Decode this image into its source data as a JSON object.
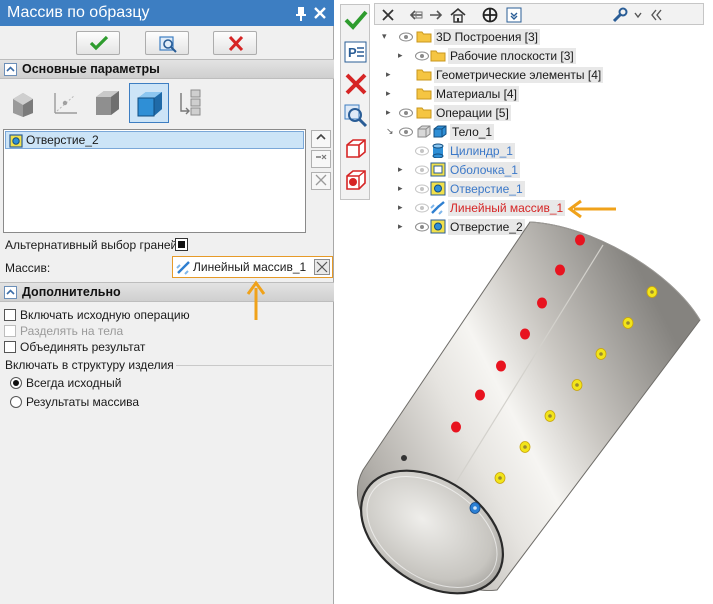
{
  "dialog": {
    "title": "Массив по образцу",
    "icons": {
      "pin": "pin-icon",
      "close": "close-icon"
    }
  },
  "commands": {
    "ok_icon": "checkmark-icon",
    "preview_icon": "preview-icon",
    "cancel_icon": "cancel-x-icon"
  },
  "main_section": {
    "title": "Основные параметры",
    "mode_icons": [
      "face-mode-icon",
      "edge-mode-icon",
      "body-mode-icon",
      "solid-mode-icon",
      "pattern-mode-icon"
    ],
    "selected_mode_index": 3,
    "list_items": [
      "Отверстие_2"
    ],
    "alt_face_selection_label": "Альтернативный выбор граней:",
    "pattern_label": "Массив:",
    "pattern_value": "Линейный массив_1"
  },
  "extra_section": {
    "title": "Дополнительно",
    "include_original_label": "Включать исходную операцию",
    "split_bodies_label": "Разделять на тела",
    "merge_result_label": "Объединять результат",
    "structure_group_label": "Включать в структуру изделия",
    "radio_always_original": "Всегда исходный",
    "radio_array_results": "Результаты массива"
  },
  "tree": {
    "nodes": [
      {
        "label": "3D Построения [3]",
        "style": "normal"
      },
      {
        "label": "Рабочие плоскости [3]",
        "style": "normal"
      },
      {
        "label": "Геометрические элементы [4]",
        "style": "normal"
      },
      {
        "label": "Материалы [4]",
        "style": "normal"
      },
      {
        "label": "Операции [5]",
        "style": "normal"
      },
      {
        "label": "Тело_1",
        "style": "normal"
      },
      {
        "label": "Цилиндр_1",
        "style": "blue"
      },
      {
        "label": "Оболочка_1",
        "style": "blue"
      },
      {
        "label": "Отверстие_1",
        "style": "blue"
      },
      {
        "label": "Линейный массив_1",
        "style": "red"
      },
      {
        "label": "Отверстие_2",
        "style": "normal"
      }
    ]
  },
  "colors": {
    "accent": "#3d7ec2",
    "ok_green": "#2e9c2e",
    "cancel_red": "#d62525",
    "highlight_orange": "#f0a21a",
    "hole_red": "#e8131f",
    "hole_yellow": "#f2e51a",
    "hole_blue": "#2a7fd4"
  }
}
